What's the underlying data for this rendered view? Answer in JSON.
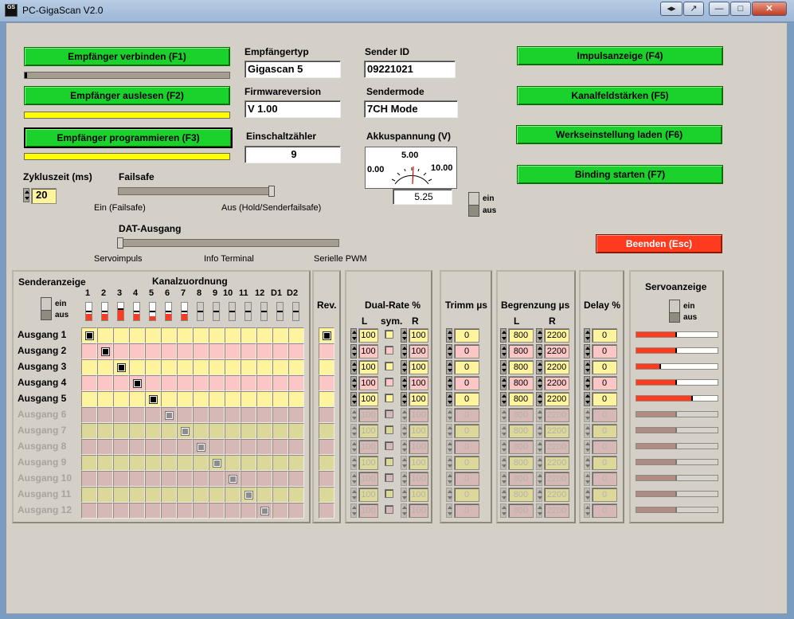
{
  "window": {
    "title": "PC-GigaScan V2.0",
    "icon_text": "GS",
    "btn_restore": "◂▸",
    "btn_arrow": "↗",
    "btn_min": "—",
    "btn_max": "□",
    "btn_close": "✕"
  },
  "buttons": {
    "connect": "Empfänger verbinden (F1)",
    "read": "Empfänger auslesen (F2)",
    "program": "Empfänger programmieren (F3)",
    "impuls": "Impulsanzeige (F4)",
    "kanal": "Kanalfeldstärken (F5)",
    "werks": "Werkseinstellung laden (F6)",
    "binding": "Binding starten (F7)",
    "exit": "Beenden (Esc)"
  },
  "progress": {
    "connect": 0.01,
    "read": 1.0,
    "program": 1.0
  },
  "receiver": {
    "type_label": "Empfängertyp",
    "type_value": "Gigascan 5",
    "fw_label": "Firmwareversion",
    "fw_value": "V 1.00",
    "count_label": "Einschaltzähler",
    "count_value": "9"
  },
  "sender": {
    "id_label": "Sender ID",
    "id_value": "09221021",
    "mode_label": "Sendermode",
    "mode_value": "7CH Mode"
  },
  "akku": {
    "label": "Akkuspannung (V)",
    "min": "0.00",
    "mid": "5.00",
    "max": "10.00",
    "value": "5.25",
    "ein": "ein",
    "aus": "aus"
  },
  "cycle": {
    "label": "Zykluszeit (ms)",
    "value": "20"
  },
  "failsafe": {
    "label": "Failsafe",
    "left": "Ein (Failsafe)",
    "right": "Aus (Hold/Senderfailsafe)",
    "position": 1.0
  },
  "dat": {
    "label": "DAT-Ausgang",
    "a": "Servoimpuls",
    "b": "Info Terminal",
    "c": "Serielle PWM",
    "position": 0.0
  },
  "matrix": {
    "sender_label": "Senderanzeige",
    "zuordnung_label": "Kanalzuordnung",
    "ein": "ein",
    "aus": "aus",
    "channels": [
      "1",
      "2",
      "3",
      "4",
      "5",
      "6",
      "7",
      "8",
      "9",
      "10",
      "11",
      "12",
      "D1",
      "D2"
    ],
    "levels": [
      0.35,
      0.35,
      0.65,
      0.35,
      0.25,
      0.35,
      0.35,
      0.0,
      0.0,
      0.0,
      0.0,
      0.0,
      0.0,
      0.0
    ],
    "rows": [
      "Ausgang 1",
      "Ausgang 2",
      "Ausgang 3",
      "Ausgang 4",
      "Ausgang 5",
      "Ausgang 6",
      "Ausgang 7",
      "Ausgang 8",
      "Ausgang 9",
      "Ausgang 10",
      "Ausgang 11",
      "Ausgang 12"
    ]
  },
  "rev": {
    "label": "Rev."
  },
  "dualrate": {
    "label": "Dual-Rate %",
    "l": "L",
    "sym": "sym.",
    "r": "R",
    "vals": [
      "100",
      "100",
      "100",
      "100",
      "100",
      "100",
      "100",
      "100",
      "100",
      "100",
      "100",
      "100"
    ]
  },
  "trimm": {
    "label": "Trimm µs",
    "vals": [
      "0",
      "0",
      "0",
      "0",
      "0",
      "0",
      "0",
      "0",
      "0",
      "0",
      "0",
      "0"
    ]
  },
  "begrenzung": {
    "label": "Begrenzung µs",
    "l": "L",
    "r": "R",
    "lvals": [
      "800",
      "800",
      "800",
      "800",
      "800",
      "800",
      "800",
      "800",
      "800",
      "800",
      "800",
      "800"
    ],
    "rvals": [
      "2200",
      "2200",
      "2200",
      "2200",
      "2200",
      "2200",
      "2200",
      "2200",
      "2200",
      "2200",
      "2200",
      "2200"
    ]
  },
  "delay": {
    "label": "Delay %",
    "vals": [
      "0",
      "0",
      "0",
      "0",
      "0",
      "0",
      "0",
      "0",
      "0",
      "0",
      "0",
      "0"
    ]
  },
  "servo": {
    "label": "Servoanzeige",
    "ein": "ein",
    "aus": "aus",
    "levels": [
      0.5,
      0.5,
      0.3,
      0.5,
      0.7,
      0.5,
      0.5,
      0.5,
      0.5,
      0.5,
      0.5,
      0.5
    ]
  },
  "colors": {
    "green": "#1bd12b",
    "red": "#ff3b1f",
    "yellow": "#fff49e",
    "pink": "#fbc6c6"
  }
}
